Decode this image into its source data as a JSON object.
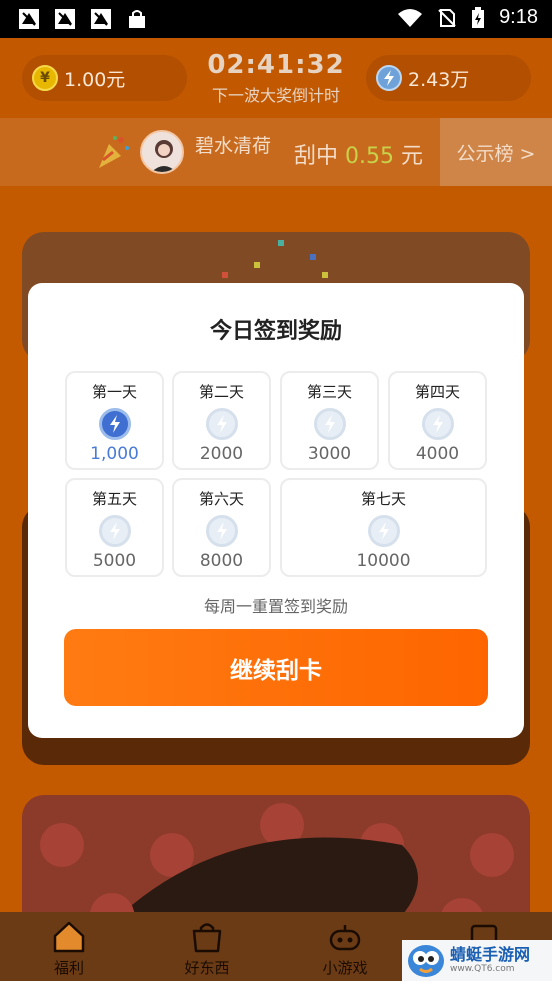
{
  "status_bar": {
    "time": "9:18"
  },
  "header": {
    "cash_balance": "1.00元",
    "countdown_time": "02:41:32",
    "countdown_label": "下一波大奖倒计时",
    "coin_balance": "2.43万",
    "cash_icon": "yuan-coin-icon",
    "coin_icon": "lightning-coin-icon"
  },
  "winner_banner": {
    "user_name": "碧水清荷",
    "win_prefix": "刮中",
    "win_amount": "0.55",
    "win_unit": "元",
    "board_button": "公示榜 >"
  },
  "modal": {
    "title": "今日签到奖励",
    "days": [
      {
        "label": "第一天",
        "amount": "1,000",
        "claimed": true
      },
      {
        "label": "第二天",
        "amount": "2000",
        "claimed": false
      },
      {
        "label": "第三天",
        "amount": "3000",
        "claimed": false
      },
      {
        "label": "第四天",
        "amount": "4000",
        "claimed": false
      },
      {
        "label": "第五天",
        "amount": "5000",
        "claimed": false
      },
      {
        "label": "第六天",
        "amount": "8000",
        "claimed": false
      },
      {
        "label": "第七天",
        "amount": "10000",
        "claimed": false
      }
    ],
    "note": "每周一重置签到奖励",
    "cta_label": "继续刮卡"
  },
  "bottom_nav": {
    "items": [
      {
        "label": "福利",
        "icon": "house-icon"
      },
      {
        "label": "好东西",
        "icon": "shopping-bag-icon"
      },
      {
        "label": "小游戏",
        "icon": "gamepad-icon"
      }
    ]
  },
  "watermark": {
    "title": "蜻蜓手游网",
    "url": "www.QT6.com"
  },
  "colors": {
    "accent": "#ff7b12",
    "header_bg": "#c25800",
    "claimed_blue": "#4a7bd6"
  }
}
